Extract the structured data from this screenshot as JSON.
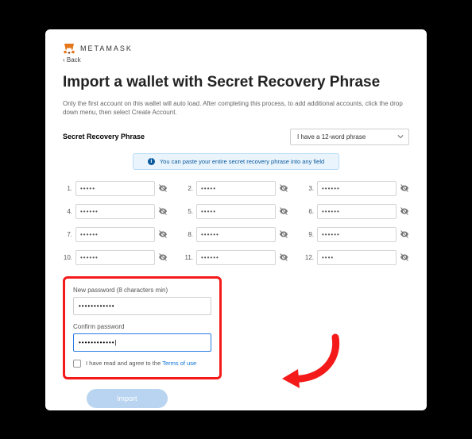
{
  "brand": "METAMASK",
  "back": "‹ Back",
  "title": "Import a wallet with Secret Recovery Phrase",
  "description": "Only the first account on this wallet will auto load. After completing this process, to add additional accounts, click the drop down menu, then select Create Account.",
  "srp_label": "Secret Recovery Phrase",
  "phrase_length": "I have a 12-word phrase",
  "hint": "You can paste your entire secret recovery phrase into any field",
  "words": [
    {
      "n": "1.",
      "v": "•••••"
    },
    {
      "n": "2.",
      "v": "•••••"
    },
    {
      "n": "3.",
      "v": "••••••"
    },
    {
      "n": "4.",
      "v": "••••••"
    },
    {
      "n": "5.",
      "v": "•••••"
    },
    {
      "n": "6.",
      "v": "••••••"
    },
    {
      "n": "7.",
      "v": "••••••"
    },
    {
      "n": "8.",
      "v": "••••••"
    },
    {
      "n": "9.",
      "v": "••••••"
    },
    {
      "n": "10.",
      "v": "••••••"
    },
    {
      "n": "11.",
      "v": "••••••"
    },
    {
      "n": "12.",
      "v": "••••"
    }
  ],
  "password": {
    "new_label": "New password (8 characters min)",
    "new_value": "••••••••••••",
    "confirm_label": "Confirm password",
    "confirm_value": "••••••••••••|"
  },
  "terms": {
    "prefix": "I have read and agree to the ",
    "link": "Terms of use"
  },
  "import_btn": "Import"
}
